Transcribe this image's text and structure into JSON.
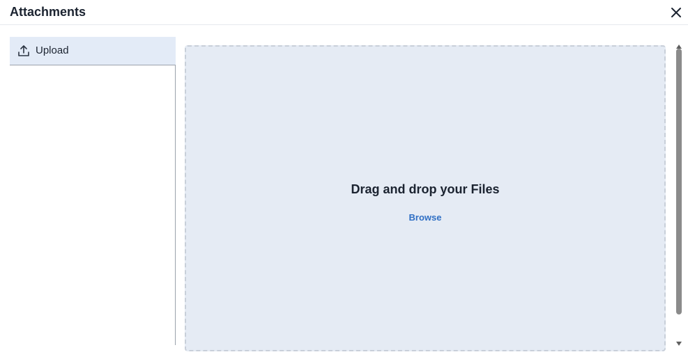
{
  "dialog": {
    "title": "Attachments"
  },
  "sidebar": {
    "items": [
      {
        "label": "Upload",
        "icon": "upload-icon",
        "selected": true
      }
    ]
  },
  "dropzone": {
    "prompt": "Drag and drop your Files",
    "browse_label": "Browse"
  },
  "colors": {
    "accent": "#2f6fc4",
    "selected_bg": "#e3ebf7",
    "dropzone_bg": "#e5ebf4",
    "text": "#1b2330"
  }
}
